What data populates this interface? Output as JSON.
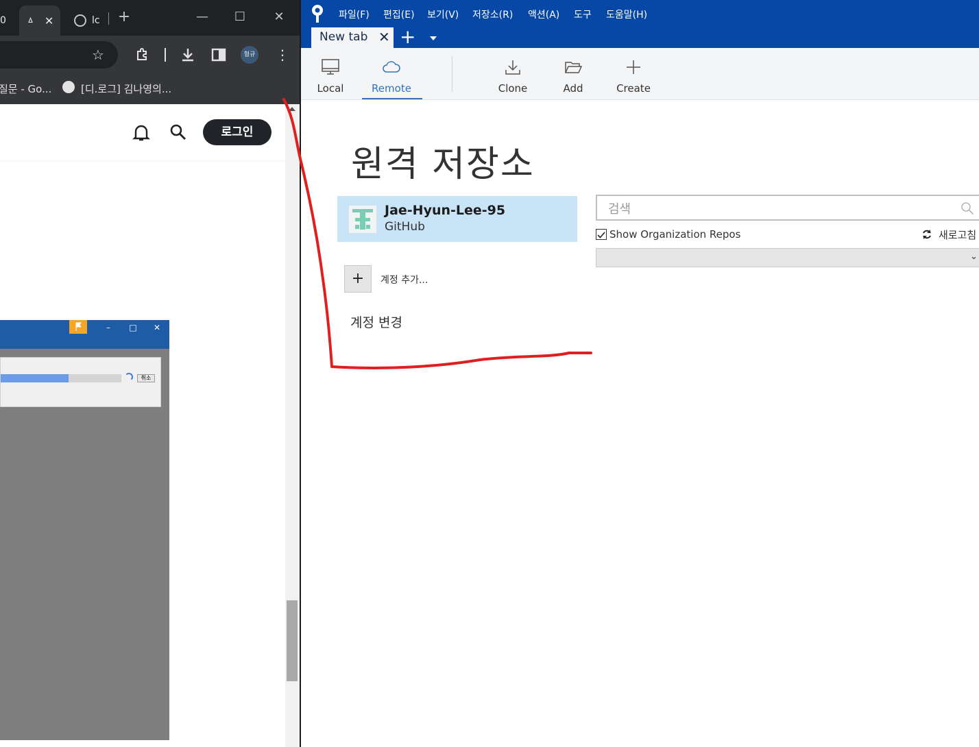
{
  "browser": {
    "tabs": [
      {
        "label": "0"
      },
      {
        "label": "ㅿ"
      },
      {
        "label": "lc"
      }
    ],
    "bookmarks": [
      "질문 - Go...",
      "[디.로그] 김나영의..."
    ],
    "profile_label": "형규",
    "login_label": "로그인"
  },
  "dialog": {
    "cancel_label": "취소",
    "progress": 0.56
  },
  "sourcetree": {
    "menu": [
      "파일(F)",
      "편집(E)",
      "보기(V)",
      "저장소(R)",
      "액션(A)",
      "도구",
      "도움말(H)"
    ],
    "tab_label": "New tab",
    "ribbon": {
      "local": "Local",
      "remote": "Remote",
      "clone": "Clone",
      "add": "Add",
      "create": "Create"
    },
    "heading": "원격 저장소",
    "account": {
      "name": "Jae-Hyun-Lee-95",
      "provider": "GitHub"
    },
    "add_account_label": "계정 추가...",
    "change_account_label": "계정 변경",
    "search_placeholder": "검색",
    "show_org_repos_label": "Show Organization Repos",
    "show_org_repos_checked": true,
    "refresh_label": "새로고침",
    "accent_color": "#0747a6",
    "selection_color": "#c8e4f6"
  }
}
